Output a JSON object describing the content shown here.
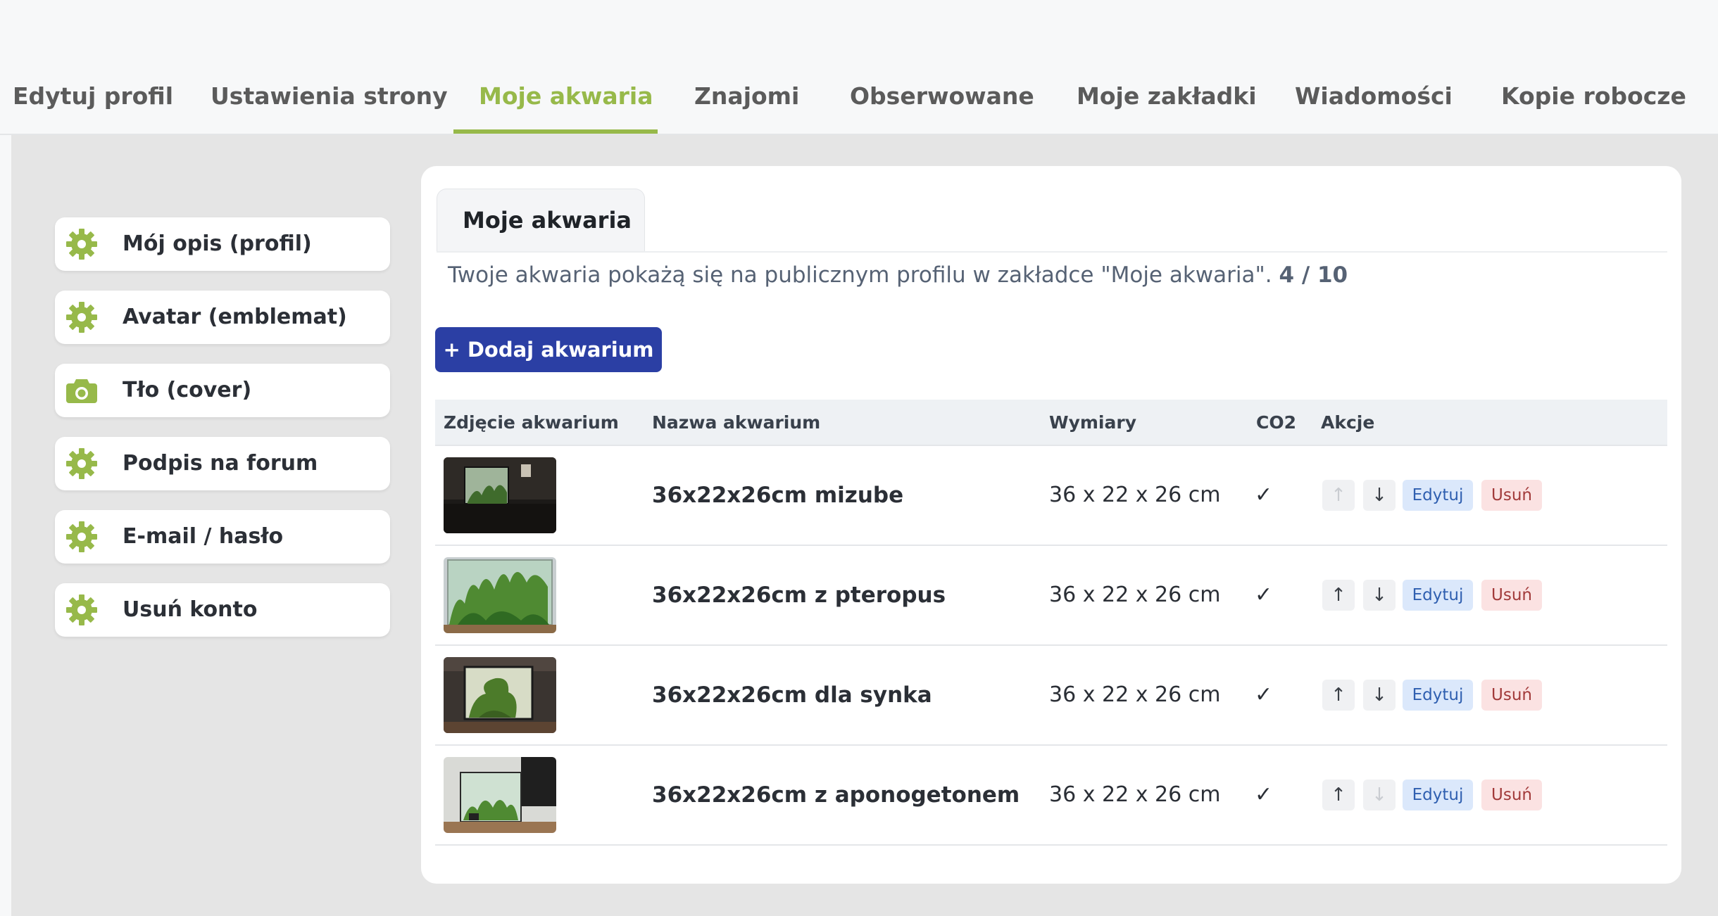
{
  "nav": {
    "tabs": [
      {
        "label": "Edytuj profil"
      },
      {
        "label": "Ustawienia strony"
      },
      {
        "label": "Moje akwaria"
      },
      {
        "label": "Znajomi"
      },
      {
        "label": "Obserwowane"
      },
      {
        "label": "Moje zakładki"
      },
      {
        "label": "Wiadomości"
      },
      {
        "label": "Kopie robocze"
      }
    ],
    "active_tab": "Moje akwaria"
  },
  "sidebar": {
    "items": [
      {
        "label": "Mój opis (profil)",
        "icon": "gear-icon"
      },
      {
        "label": "Avatar (emblemat)",
        "icon": "gear-icon"
      },
      {
        "label": "Tło (cover)",
        "icon": "camera-icon"
      },
      {
        "label": "Podpis na forum",
        "icon": "gear-icon"
      },
      {
        "label": "E-mail / hasło",
        "icon": "gear-icon"
      },
      {
        "label": "Usuń konto",
        "icon": "gear-icon"
      }
    ]
  },
  "main": {
    "tab_label": "Moje akwaria",
    "info_text": "Twoje akwaria pokażą się na publicznym profilu w zakładce \"Moje akwaria\". ",
    "count": "4 / 10",
    "add_button": "+ Dodaj akwarium",
    "table": {
      "headers": [
        "Zdjęcie akwarium",
        "Nazwa akwarium",
        "Wymiary",
        "CO2",
        "Akcje"
      ],
      "rows": [
        {
          "name": "36x22x26cm mizube",
          "dims": "36 x 22 x 26 cm",
          "co2": "✓",
          "up": "↑",
          "down": "↓",
          "up_enabled": false,
          "down_enabled": true,
          "edit": "Edytuj",
          "delete": "Usuń"
        },
        {
          "name": "36x22x26cm z pteropus",
          "dims": "36 x 22 x 26 cm",
          "co2": "✓",
          "up": "↑",
          "down": "↓",
          "up_enabled": true,
          "down_enabled": true,
          "edit": "Edytuj",
          "delete": "Usuń"
        },
        {
          "name": "36x22x26cm dla synka",
          "dims": "36 x 22 x 26 cm",
          "co2": "✓",
          "up": "↑",
          "down": "↓",
          "up_enabled": true,
          "down_enabled": true,
          "edit": "Edytuj",
          "delete": "Usuń"
        },
        {
          "name": "36x22x26cm z aponogetonem",
          "dims": "36 x 22 x 26 cm",
          "co2": "✓",
          "up": "↑",
          "down": "↓",
          "up_enabled": true,
          "down_enabled": false,
          "edit": "Edytuj",
          "delete": "Usuń"
        }
      ]
    }
  },
  "colors": {
    "accent": "#97b94a",
    "primary_button": "#2b3fa4",
    "edit_bg": "#dbe8fb",
    "delete_bg": "#fbe2e2"
  }
}
